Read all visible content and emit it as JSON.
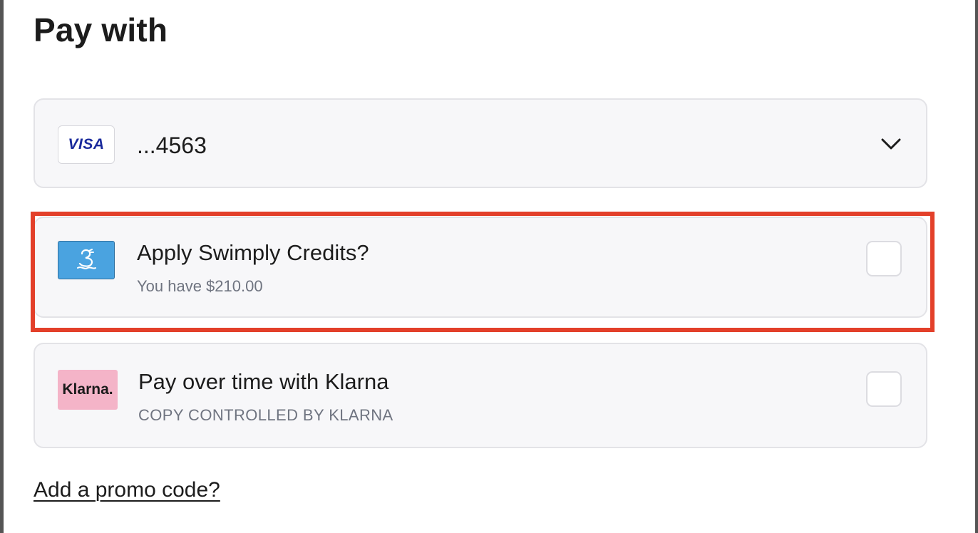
{
  "header": {
    "title": "Pay with"
  },
  "payment_method": {
    "brand_icon": "visa-logo",
    "brand_text": "VISA",
    "masked_number": "...4563"
  },
  "credits": {
    "icon": "swimply-logo",
    "title": "Apply Swimply Credits?",
    "subtitle": "You have $210.00",
    "checked": false
  },
  "klarna": {
    "logo_text": "Klarna.",
    "title": "Pay over time with Klarna",
    "subtitle": "COPY CONTROLLED BY KLARNA",
    "checked": false
  },
  "promo": {
    "link_text": "Add a promo code?"
  },
  "colors": {
    "highlight": "#e3402a",
    "visa_blue": "#1a2a9c",
    "swimply_blue": "#4aa3e0",
    "klarna_pink": "#f4b4c8"
  }
}
